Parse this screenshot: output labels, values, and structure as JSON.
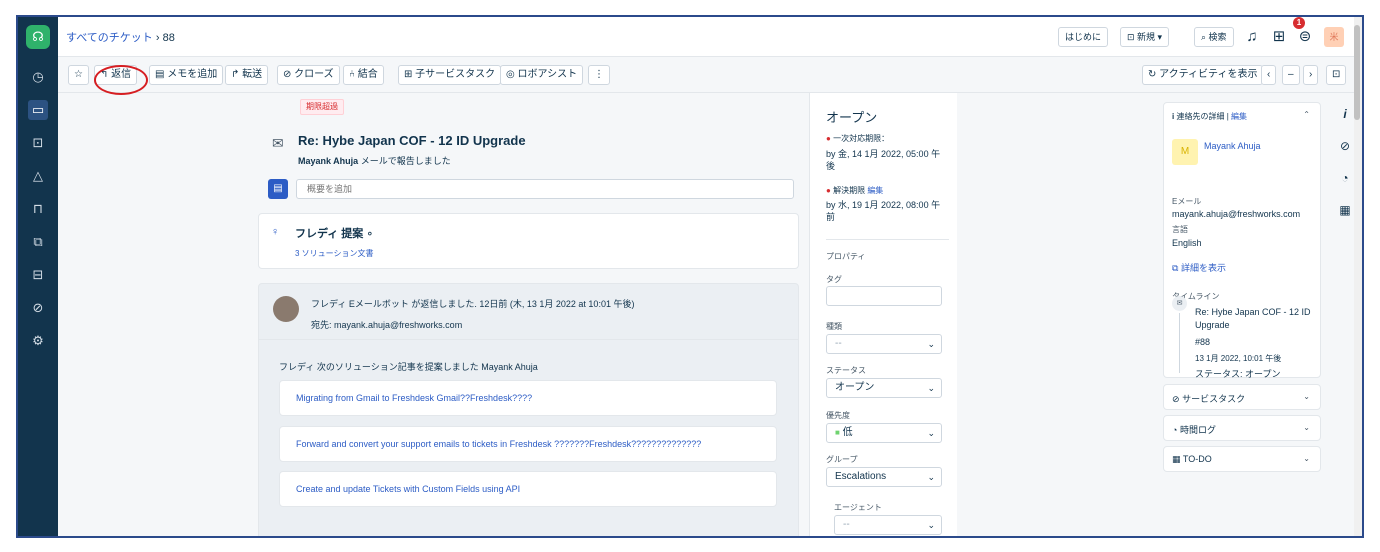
{
  "breadcrumb": {
    "all_tickets": "すべてのチケット",
    "sep": "›",
    "ticket_no": "88"
  },
  "topbar": {
    "getting_started": "はじめに",
    "new_button": "⊡ 新規 ▾",
    "search_button": "⌕ 検索",
    "notification_count": "1",
    "avatar_initial": "米"
  },
  "toolbar": {
    "star": "☆",
    "reply": "↰ 返信",
    "add_note": "▤ メモを追加",
    "forward": "↱ 転送",
    "close": "⊘ クローズ",
    "merge": "⑃ 結合",
    "child_service_task": "⊞ 子サービスタスク",
    "robo_assist": "◎ ロボアシスト",
    "more": "⋮",
    "show_activity": "↻ アクティビティを表示",
    "prev": "‹",
    "middle": "–",
    "next": "›",
    "expand": "⊡"
  },
  "ticket": {
    "overdue_tag": "期限超過",
    "subject": "Re: Hybe Japan COF - 12 ID Upgrade",
    "reporter_name": "Mayank Ahuja",
    "reporter_suffix": " メールで報告しました",
    "summary_placeholder": "概要を追加"
  },
  "freddy": {
    "title": "フレディ 提案 ∘",
    "solutions": "3 ソリューション文書"
  },
  "activity": {
    "bot_line": "フレディ Eメールボット が返信しました. 12日前 (木, 13 1月 2022 at 10:01 午後)",
    "to_line": "宛先: mayank.ahuja@freshworks.com",
    "suggested": "フレディ 次のソリューション記事を提案しました Mayank Ahuja",
    "articles": [
      "Migrating from Gmail to Freshdesk Gmail??Freshdesk????",
      "Forward and convert your support emails to tickets in Freshdesk ???????Freshdesk??????????????",
      "Create and update Tickets with Custom Fields using API"
    ]
  },
  "properties": {
    "status_title": "オープン",
    "first_response_label": "一次対応期限：",
    "first_response_value": "by 金, 14 1月 2022, 05:00 午後",
    "resolution_label": "解決期限",
    "resolution_edit": "編集",
    "resolution_value": "by 水, 19 1月 2022, 08:00 午前",
    "section": "プロパティ",
    "tags_label": "タグ",
    "type_label": "種類",
    "type_value": "--",
    "status_label": "ステータス",
    "status_value": "オープン",
    "priority_label": "優先度",
    "priority_value": "低",
    "group_label": "グループ",
    "group_value": "Escalations",
    "agent_label": "エージェント",
    "agent_value": "--"
  },
  "contact": {
    "header": "連絡先の詳細",
    "edit": "編集",
    "avatar_initial": "M",
    "name": "Mayank Ahuja",
    "email_label": "Eメール",
    "email": "mayank.ahuja@freshworks.com",
    "language_label": "言語",
    "language": "English",
    "details_link": "詳細を表示",
    "timeline_label": "タイムライン",
    "tl_title1": "Re: Hybe Japan COF - 12 ID",
    "tl_title2": "Upgrade",
    "tl_id": "#88",
    "tl_date": "13 1月 2022, 10:01 午後",
    "tl_status": "ステータス: オープン"
  },
  "panels": {
    "service_tasks": "サービスタスク",
    "time_log": "時間ログ",
    "todo": "TO-DO"
  }
}
